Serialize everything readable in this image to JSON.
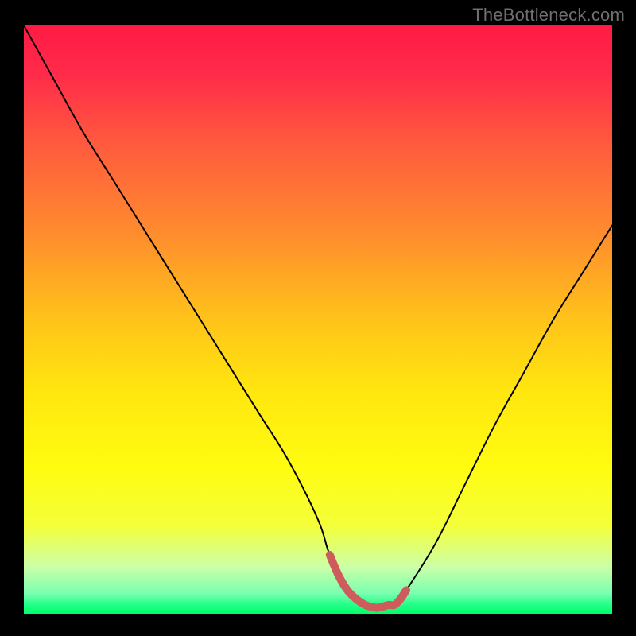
{
  "watermark": "TheBottleneck.com",
  "chart_data": {
    "type": "line",
    "title": "",
    "xlabel": "",
    "ylabel": "",
    "xlim": [
      0,
      100
    ],
    "ylim": [
      0,
      100
    ],
    "grid": false,
    "series": [
      {
        "name": "curve",
        "x": [
          0,
          5,
          10,
          15,
          20,
          25,
          30,
          35,
          40,
          45,
          50,
          52,
          55,
          58,
          60,
          63,
          65,
          70,
          75,
          80,
          85,
          90,
          95,
          100
        ],
        "y": [
          100,
          91,
          82,
          74,
          66,
          58,
          50,
          42,
          34,
          26,
          16,
          10,
          4,
          1.5,
          1.0,
          1.5,
          4,
          12,
          22,
          32,
          41,
          50,
          58,
          66
        ],
        "color": "#000000",
        "width": 2
      },
      {
        "name": "highlight",
        "x": [
          52,
          53.5,
          55,
          56.5,
          58,
          59,
          60,
          61,
          62,
          63,
          64,
          65
        ],
        "y": [
          10,
          6.5,
          4,
          2.5,
          1.5,
          1.2,
          1.0,
          1.2,
          1.5,
          1.5,
          2.5,
          4
        ],
        "color": "#cd5c5c",
        "width": 10
      }
    ],
    "background_gradient": {
      "stops": [
        {
          "offset": 0.0,
          "color": "#ff1a44"
        },
        {
          "offset": 0.08,
          "color": "#ff2a4a"
        },
        {
          "offset": 0.2,
          "color": "#ff5a3e"
        },
        {
          "offset": 0.35,
          "color": "#ff8b2e"
        },
        {
          "offset": 0.5,
          "color": "#ffc31a"
        },
        {
          "offset": 0.62,
          "color": "#ffe60f"
        },
        {
          "offset": 0.75,
          "color": "#fffc10"
        },
        {
          "offset": 0.85,
          "color": "#f4ff3a"
        },
        {
          "offset": 0.92,
          "color": "#ccffa6"
        },
        {
          "offset": 0.965,
          "color": "#7affb0"
        },
        {
          "offset": 0.985,
          "color": "#22ff88"
        },
        {
          "offset": 1.0,
          "color": "#00ff66"
        }
      ]
    }
  }
}
